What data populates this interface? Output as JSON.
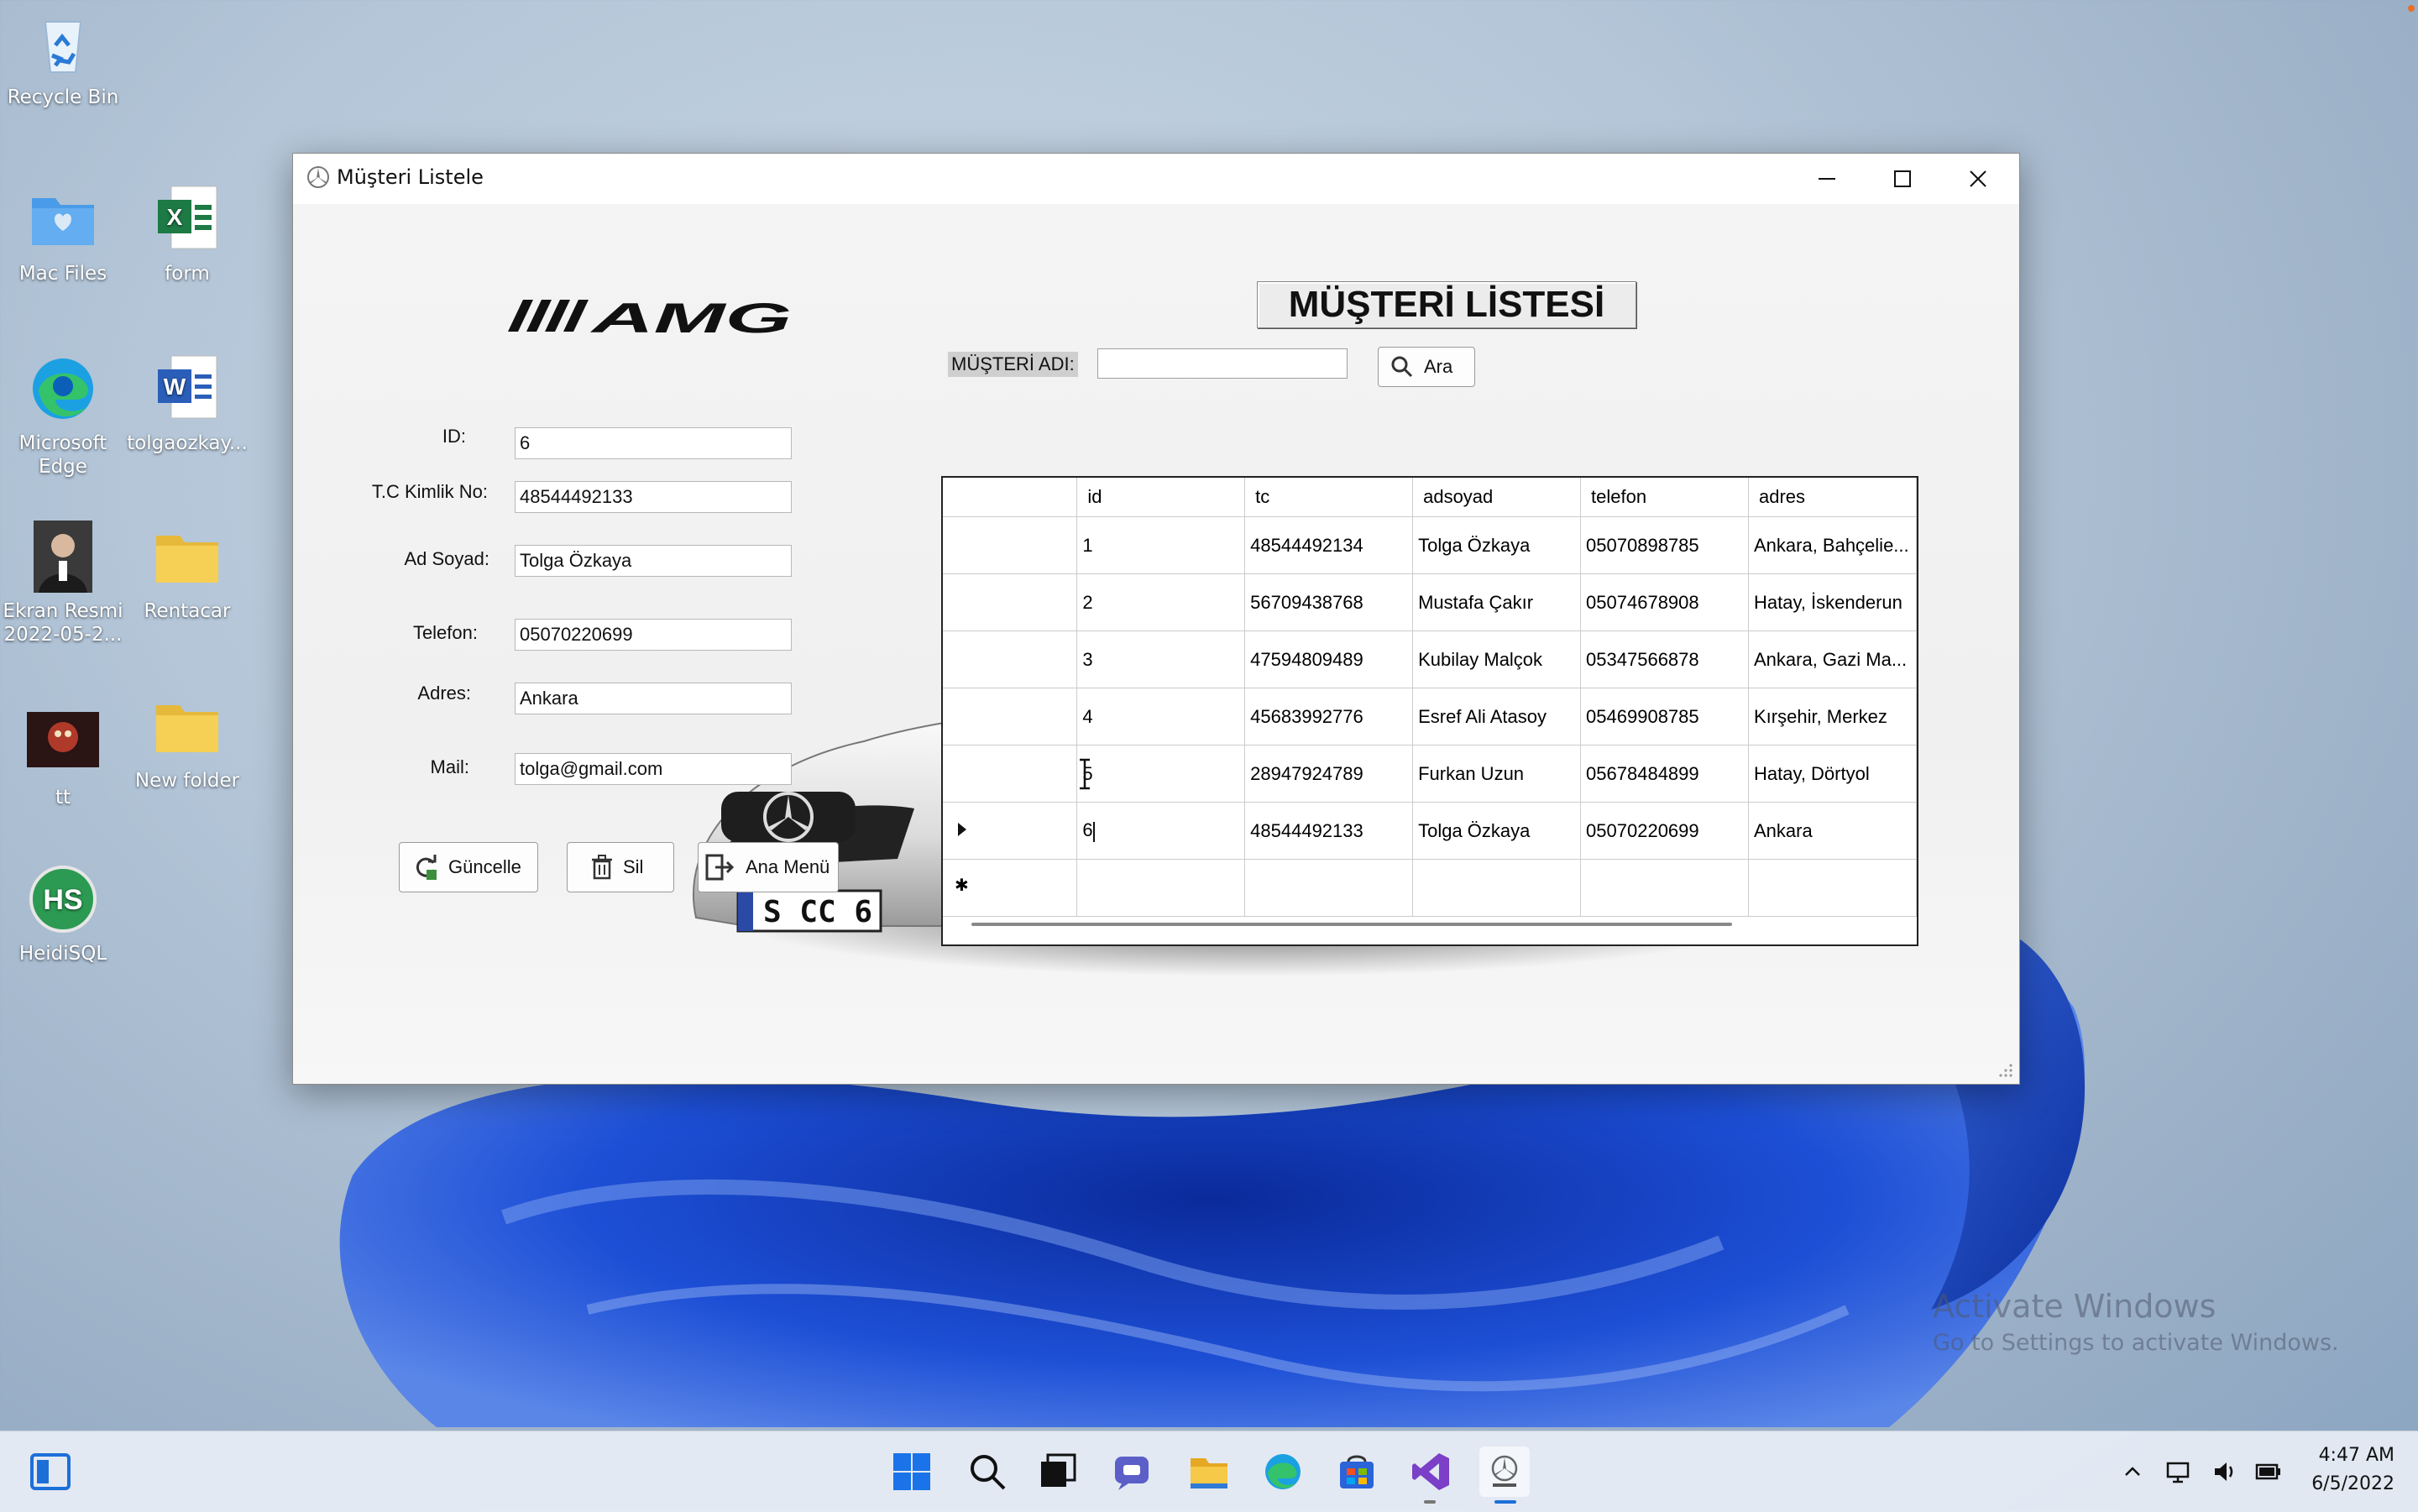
{
  "desktop": {
    "icons": [
      {
        "label": "Recycle Bin"
      },
      {
        "label": "Mac Files"
      },
      {
        "label": "form"
      },
      {
        "label": "Microsoft Edge"
      },
      {
        "label": "tolgaozkay..."
      },
      {
        "label": "Ekran Resmi 2022-05-2..."
      },
      {
        "label": "Rentacar"
      },
      {
        "label": "tt"
      },
      {
        "label": "New folder"
      },
      {
        "label": "HeidiSQL"
      }
    ],
    "watermark_title": "Activate Windows",
    "watermark_sub": "Go to Settings to activate Windows."
  },
  "window": {
    "title": "Müşteri Listele",
    "heading": "MÜŞTERİ LİSTESİ",
    "logo_text": "AMG",
    "search": {
      "label": "MÜŞTERİ ADI:",
      "value": "",
      "button": "Ara"
    },
    "form": {
      "id_label": "ID:",
      "id_value": "6",
      "tc_label": "T.C Kimlik No:",
      "tc_value": "48544492133",
      "name_label": "Ad Soyad:",
      "name_value": "Tolga Özkaya",
      "phone_label": "Telefon:",
      "phone_value": "05070220699",
      "address_label": "Adres:",
      "address_value": "Ankara",
      "mail_label": "Mail:",
      "mail_value": "tolga@gmail.com"
    },
    "buttons": {
      "update": "Güncelle",
      "delete": "Sil",
      "main_menu": "Ana Menü"
    },
    "plate_text": "S CC 6",
    "grid": {
      "columns": [
        "id",
        "tc",
        "adsoyad",
        "telefon",
        "adres"
      ],
      "rows": [
        [
          "1",
          "48544492134",
          "Tolga Özkaya",
          "05070898785",
          "Ankara, Bahçelie..."
        ],
        [
          "2",
          "56709438768",
          "Mustafa Çakır",
          "05074678908",
          "Hatay, İskenderun"
        ],
        [
          "3",
          "47594809489",
          "Kubilay Malçok",
          "05347566878",
          "Ankara, Gazi Ma..."
        ],
        [
          "4",
          "45683992776",
          "Esref Ali Atasoy",
          "05469908785",
          "Kırşehir, Merkez"
        ],
        [
          "5",
          "28947924789",
          "Furkan Uzun",
          "05678484899",
          "Hatay, Dörtyol"
        ],
        [
          "6",
          "48544492133",
          "Tolga Özkaya",
          "05070220699",
          "Ankara"
        ]
      ],
      "selected_row": 5
    }
  },
  "taskbar": {
    "time": "4:47 AM",
    "date": "6/5/2022"
  }
}
